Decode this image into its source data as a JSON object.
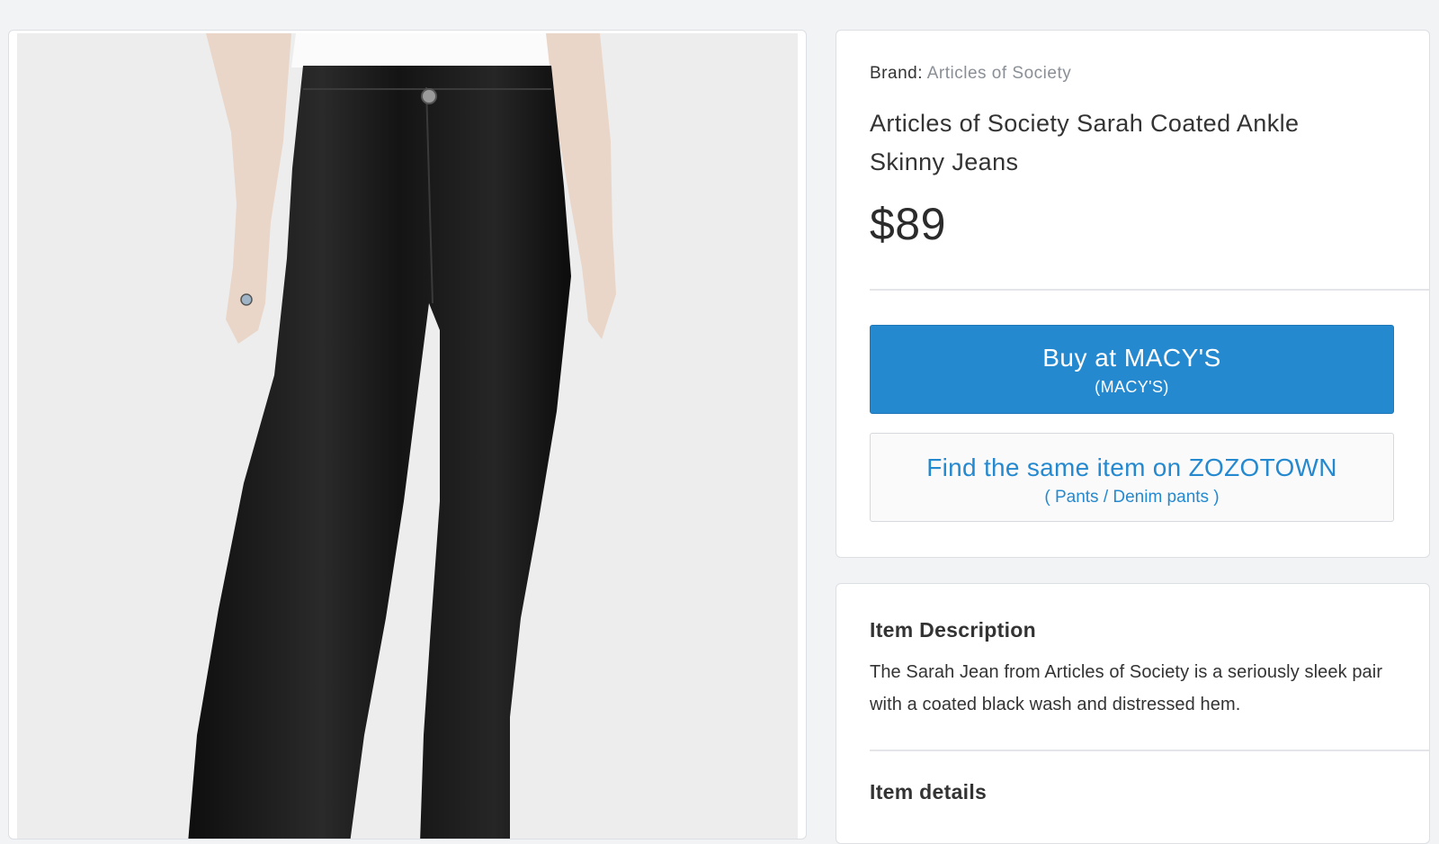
{
  "product": {
    "brand_label": "Brand:",
    "brand_name": "Articles of Society",
    "title": "Articles of Society Sarah Coated Ankle Skinny Jeans",
    "price": "$89",
    "image_icon": "black-coated-skinny-jeans-photo"
  },
  "actions": {
    "buy_label": "Buy at MACY'S",
    "buy_sublabel": "(MACY'S)",
    "zozo_label": "Find the same item on ZOZOTOWN",
    "zozo_sublabel": "( Pants / Denim pants )"
  },
  "description": {
    "heading": "Item Description",
    "text": "The Sarah Jean from Articles of Society is a seriously sleek pair with a coated black wash and distressed hem.",
    "details_heading": "Item details"
  },
  "colors": {
    "accent": "#2589d0",
    "background": "#f2f3f5",
    "jeans": "#1a1a1a"
  }
}
